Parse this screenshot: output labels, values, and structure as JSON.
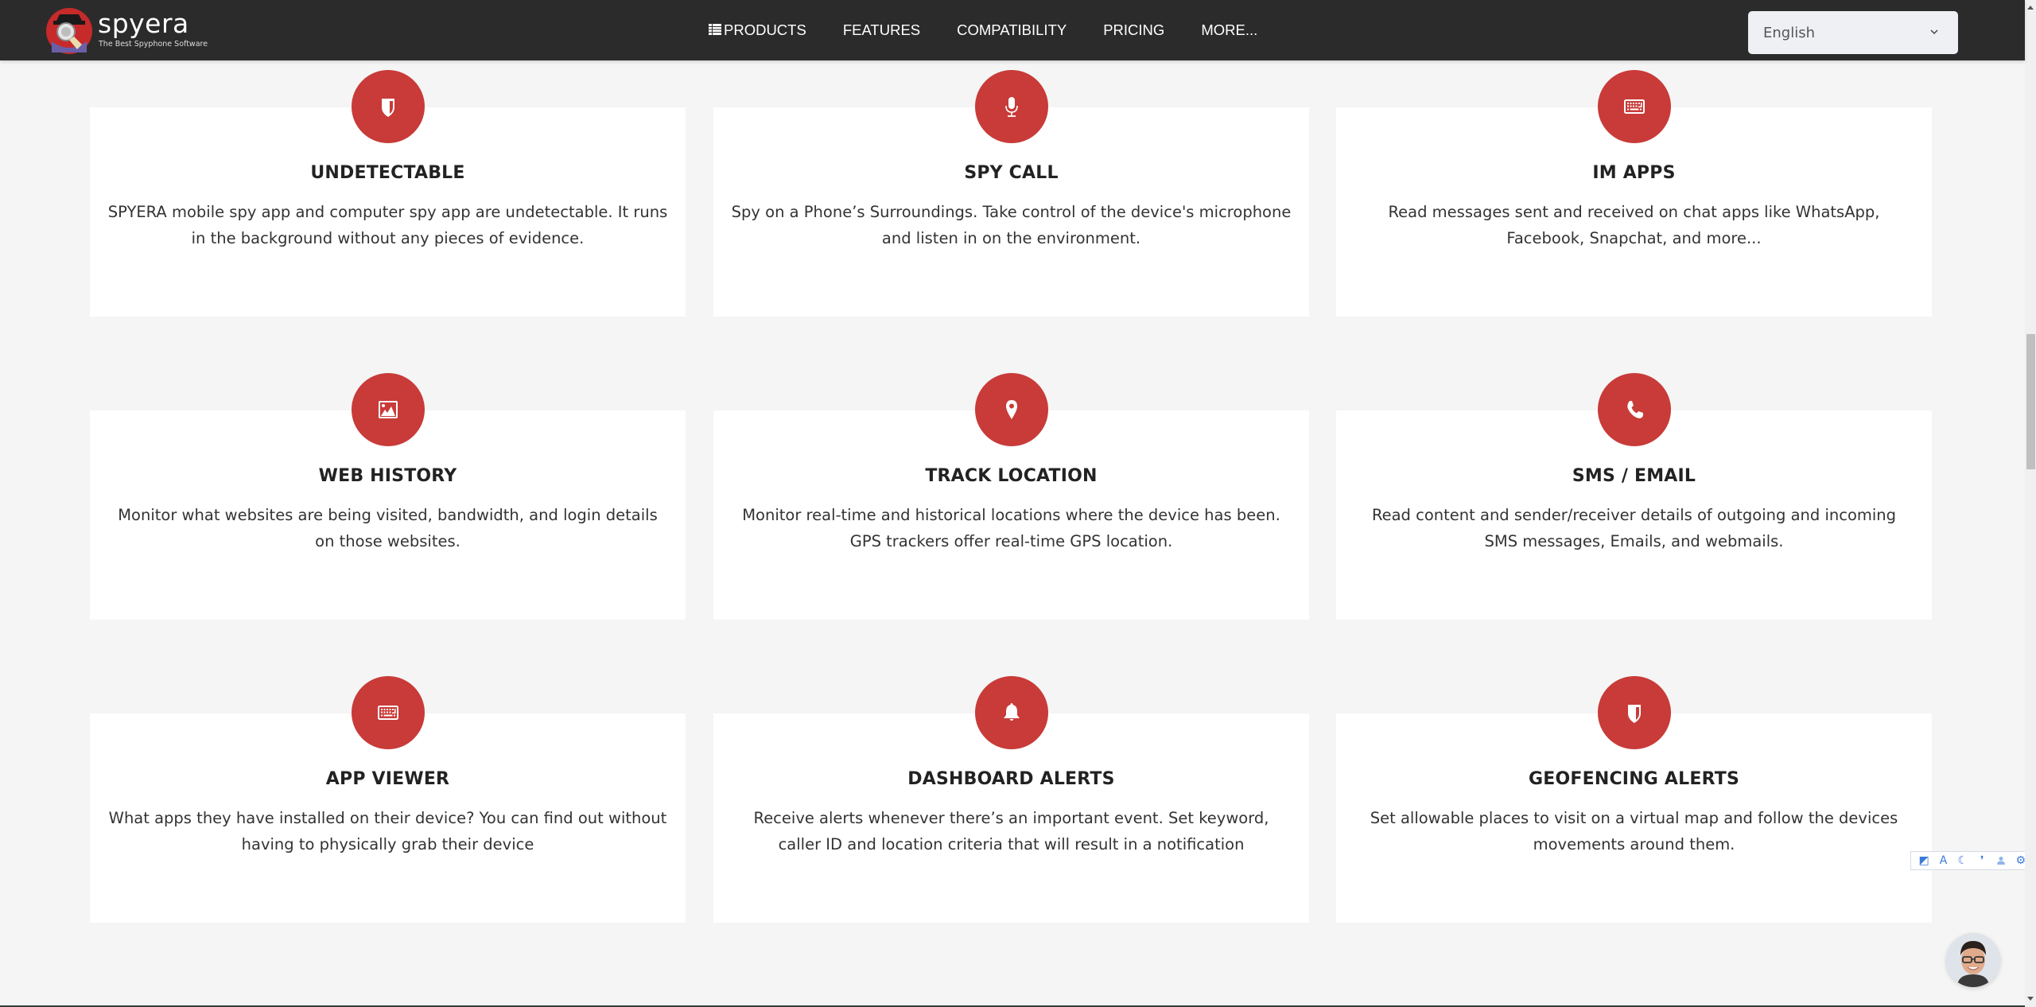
{
  "header": {
    "logo": {
      "name": "spyera",
      "tagline": "The Best Spyphone Software"
    },
    "nav": [
      {
        "label": "PRODUCTS",
        "icon": "list-icon"
      },
      {
        "label": "FEATURES"
      },
      {
        "label": "COMPATIBILITY"
      },
      {
        "label": "PRICING"
      },
      {
        "label": "MORE..."
      }
    ],
    "language_select": {
      "value": "English"
    }
  },
  "theme": {
    "accent": "#c83b38",
    "nav_bg": "#2b2b2b",
    "page_bg": "#f5f5f5"
  },
  "features": [
    {
      "icon": "shield-icon",
      "title": "UNDETECTABLE",
      "description": "SPYERA mobile spy app and computer spy app are undetectable. It runs in the background without any pieces of evidence."
    },
    {
      "icon": "microphone-icon",
      "title": "SPY CALL",
      "description": "Spy on a Phone’s Surroundings. Take control of the device's microphone and listen in on the environment."
    },
    {
      "icon": "keyboard-icon",
      "title": "IM APPS",
      "description": "Read messages sent and received on chat apps like WhatsApp, Facebook, Snapchat, and more..."
    },
    {
      "icon": "image-icon",
      "title": "WEB HISTORY",
      "description": "Monitor what websites are being visited, bandwidth, and login details on those websites."
    },
    {
      "icon": "map-pin-icon",
      "title": "TRACK LOCATION",
      "description": "Monitor real-time and historical locations where the device has been. GPS trackers offer real-time GPS location."
    },
    {
      "icon": "phone-icon",
      "title": "SMS / EMAIL",
      "description": "Read content and sender/receiver details of outgoing and incoming SMS messages, Emails, and webmails."
    },
    {
      "icon": "keyboard-icon",
      "title": "APP VIEWER",
      "description": "What apps they have installed on their device? You can find out without having to physically grab their device"
    },
    {
      "icon": "bell-icon",
      "title": "DASHBOARD ALERTS",
      "description": "Receive alerts whenever there’s an important event. Set keyword, caller ID and location criteria that will result in a notification"
    },
    {
      "icon": "shield-icon",
      "title": "GEOFENCING ALERTS",
      "description": "Set allowable places to visit on a virtual map and follow the devices movements around them."
    }
  ],
  "a11y_toolbar": {
    "items": [
      "contrast-icon",
      "font-size-icon",
      "dark-mode-icon",
      "cursor-icon",
      "user-icon",
      "settings-gear-icon"
    ],
    "glyphs": [
      "◩",
      "A",
      "☾",
      "❜",
      "👤",
      "⚙"
    ]
  }
}
